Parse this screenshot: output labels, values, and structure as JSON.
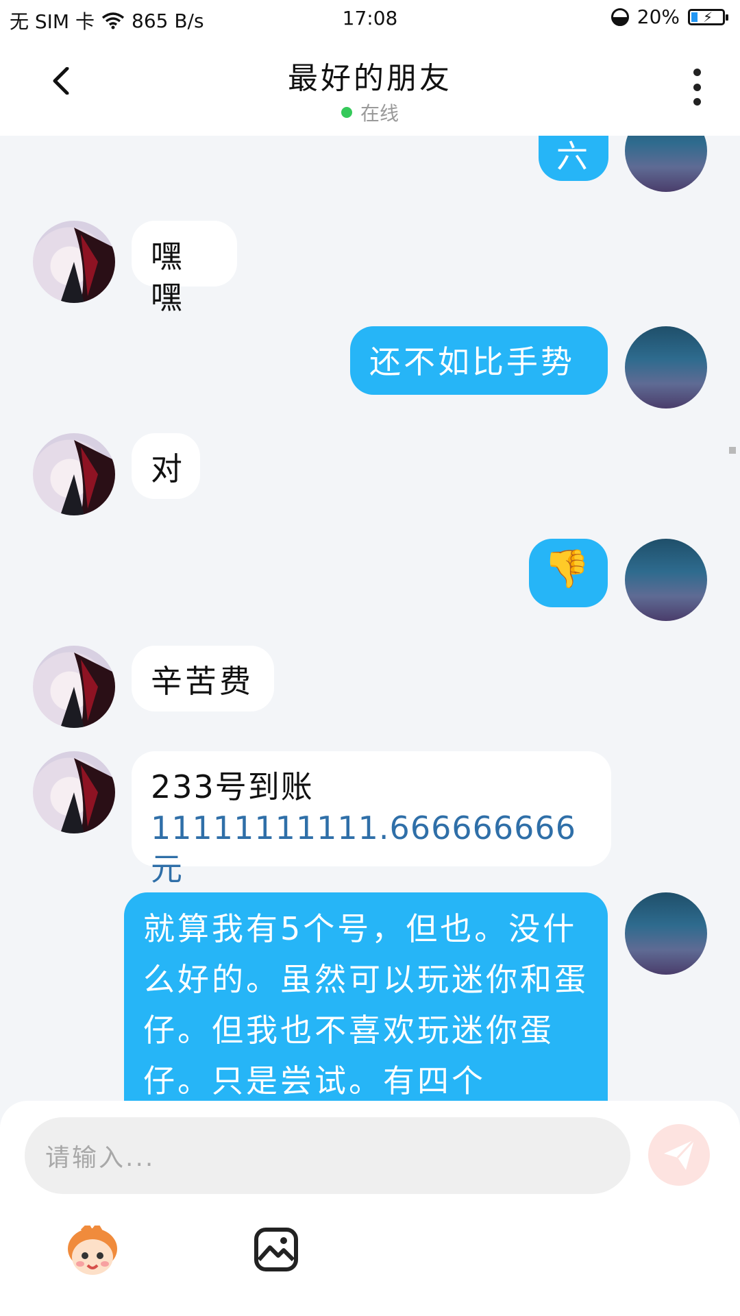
{
  "status_bar": {
    "sim": "无 SIM 卡",
    "net_speed": "865 B/s",
    "time": "17:08",
    "battery": "20%",
    "battery_level": 0.2
  },
  "header": {
    "title": "最好的朋友",
    "status": "在线"
  },
  "messages": [
    {
      "side": "right",
      "text": "六"
    },
    {
      "side": "left",
      "text": "嘿嘿"
    },
    {
      "side": "right",
      "text": "还不如比手势"
    },
    {
      "side": "left",
      "text": "对"
    },
    {
      "side": "right",
      "text": "👎"
    },
    {
      "side": "left",
      "text": "辛苦费"
    },
    {
      "side": "left",
      "line1": "233号到账",
      "line2": "11111111111.666666666元"
    },
    {
      "side": "right",
      "text": "就算我有5个号，但也。没什么好的。虽然可以玩迷你和蛋仔。但我也不喜欢玩迷你蛋仔。只是尝试。有四个"
    }
  ],
  "input": {
    "placeholder": "请输入..."
  },
  "colors": {
    "my_bubble": "#26b5f7",
    "friend_bubble": "#ffffff",
    "online_dot": "#35c95a",
    "background": "#f3f5f8"
  }
}
